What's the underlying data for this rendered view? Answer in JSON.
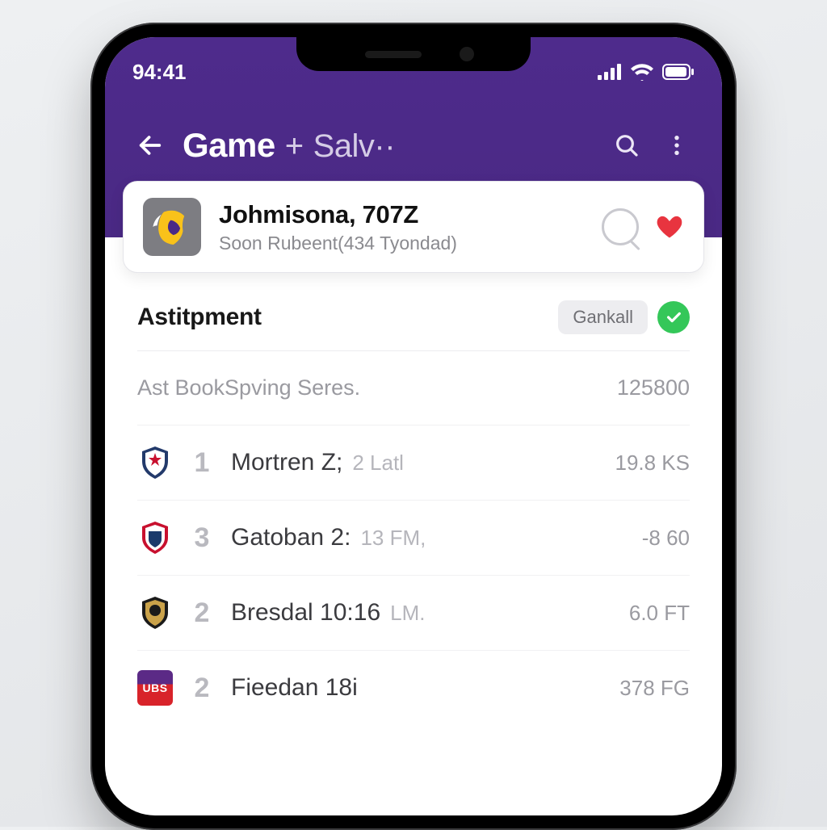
{
  "colors": {
    "accent": "#4b2a87",
    "heart": "#e8343f",
    "success": "#34c759"
  },
  "status": {
    "time": "94:41"
  },
  "header": {
    "title_primary": "Game",
    "title_connector": "+",
    "title_secondary": "Salv··"
  },
  "card": {
    "title": "Johmisona, 707Z",
    "subtitle": "Soon Rubeent(434 Tyondad)",
    "team_icon": "vikings-icon"
  },
  "section": {
    "title": "Astitpment",
    "chip_label": "Gankall"
  },
  "subheader": {
    "label": "Ast BookSpving Seres.",
    "value": "125800"
  },
  "rows": [
    {
      "icon": "star-shield-icon",
      "rank": "1",
      "name": "Mortren Z;",
      "suffix": "2 Latl",
      "value": "19.8 KS"
    },
    {
      "icon": "nfl-shield-icon",
      "rank": "3",
      "name": "Gatoban 2:",
      "suffix": "13 FM,",
      "value": "-8 60"
    },
    {
      "icon": "badge-icon",
      "rank": "2",
      "name": "Bresdal 10:16",
      "suffix": "LM.",
      "value": "6.0 FT"
    },
    {
      "icon": "ubs-icon",
      "rank": "2",
      "name": "Fieedan 18i",
      "suffix": "",
      "value": "378 FG"
    }
  ]
}
